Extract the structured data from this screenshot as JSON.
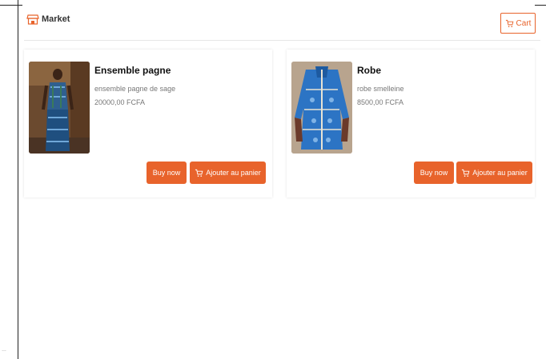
{
  "header": {
    "brand": "Market",
    "cart_label": "Cart",
    "accent_color": "#e8632b"
  },
  "products": [
    {
      "title": "Ensemble pagne",
      "description": "ensemble pagne de sage",
      "price": "20000,00 FCFA",
      "buy_label": "Buy now",
      "add_label": "Ajouter au panier"
    },
    {
      "title": "Robe",
      "description": "robe smelleine",
      "price": "8500,00 FCFA",
      "buy_label": "Buy now",
      "add_label": "Ajouter au panier"
    }
  ]
}
